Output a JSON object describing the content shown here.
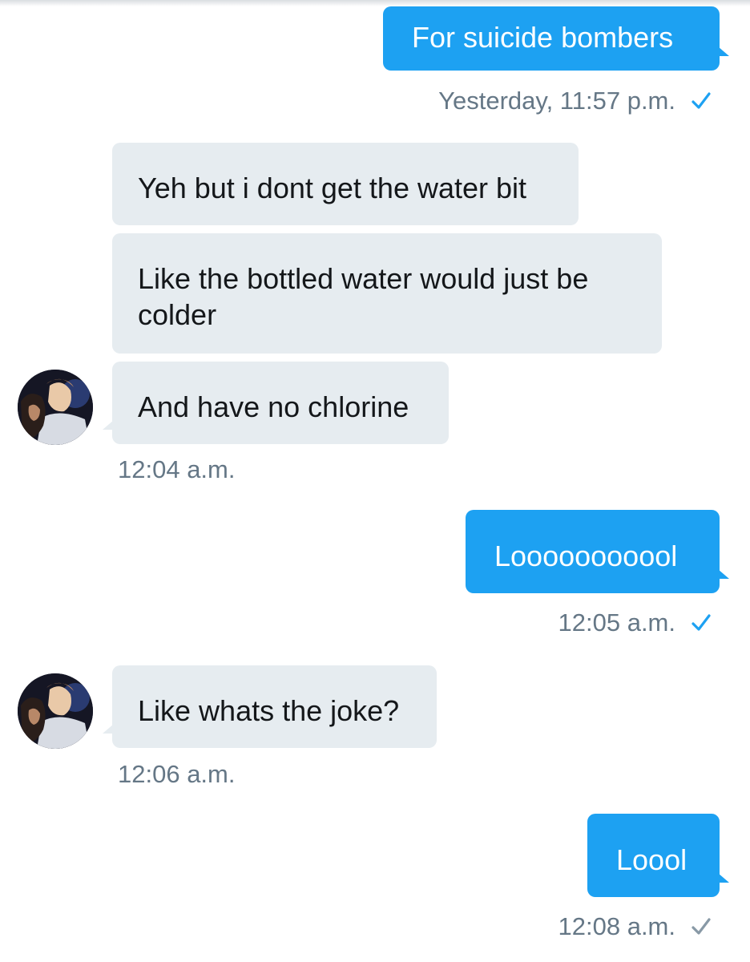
{
  "messages": {
    "m1": {
      "text": "For suicide bombers",
      "time": "Yesterday, 11:57 p.m."
    },
    "m2": {
      "text": "Yeh but i dont get the water bit"
    },
    "m3": {
      "text": "Like the bottled water would just be colder"
    },
    "m4": {
      "text": "And have no chlorine",
      "time": "12:04 a.m."
    },
    "m5": {
      "text": "Looooooooool",
      "time": "12:05 a.m."
    },
    "m6": {
      "text": "Like whats the joke?",
      "time": "12:06 a.m."
    },
    "m7": {
      "text": "Loool",
      "time": "12:08 a.m."
    }
  },
  "icons": {
    "sent_check": "check-icon",
    "avatar": "avatar-photo"
  },
  "colors": {
    "outgoing_bubble": "#1da1f2",
    "incoming_bubble": "#e6ecf0",
    "timestamp": "#657786",
    "check_read": "#1da1f2",
    "check_sent": "#8899a6"
  }
}
